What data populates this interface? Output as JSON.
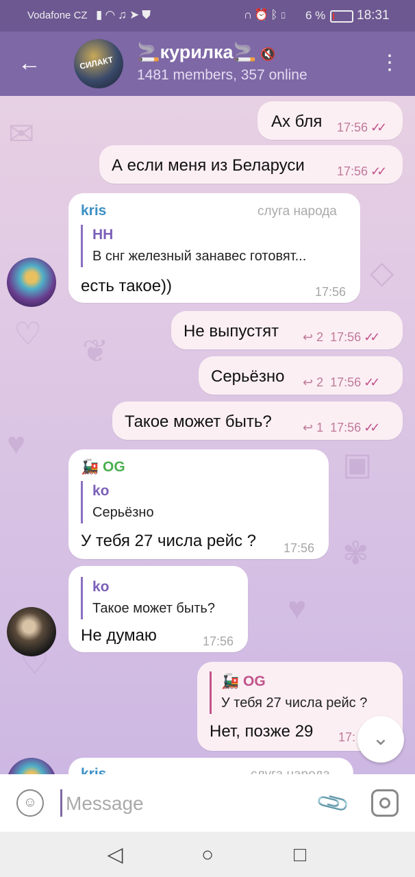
{
  "status_bar": {
    "carrier": "Vodafone CZ",
    "battery": "6 %",
    "time": "18:31",
    "battery_level": 0.06,
    "battery_color": "#e53935"
  },
  "header": {
    "title": "курилка",
    "title_emoji": "🚬",
    "subtitle": "1481 members, 357 online",
    "avatar_text": "СИЛАКТ"
  },
  "messages": [
    {
      "text": "Ах бля",
      "time": "17:56"
    },
    {
      "text": "А если меня из Беларуси",
      "time": "17:56"
    },
    {
      "sender": "kris",
      "role": "слуга народа",
      "quote_name": "НН",
      "quote_text": "В снг железный занавес готовят...",
      "text": "есть такое))",
      "time": "17:56"
    },
    {
      "text": "Не выпустят",
      "replies": "2",
      "time": "17:56"
    },
    {
      "text": "Серьёзно",
      "replies": "2",
      "time": "17:56"
    },
    {
      "text": "Такое может быть?",
      "replies": "1",
      "time": "17:56"
    },
    {
      "sender": "🚂 OG",
      "quote_name": "ko",
      "quote_text": "Серьёзно",
      "text": "У тебя 27 числа рейс ?",
      "time": "17:56"
    },
    {
      "quote_name": "ko",
      "quote_text": "Такое может быть?",
      "text": "Не думаю",
      "time": "17:56"
    },
    {
      "quote_name": "🚂 OG",
      "quote_text": "У тебя 27 числа рейс ?",
      "text": "Нет, позже 29",
      "time": "17:"
    },
    {
      "sender": "kris",
      "role": "слуга народа"
    }
  ],
  "composer": {
    "placeholder": "Message"
  },
  "colors": {
    "header": "#7e68a6",
    "status": "#6d5892",
    "outgoing_bubble": "#fbeff4",
    "check": "#c0538a",
    "sender_kris": "#3b8fc4",
    "sender_og": "#4caf50"
  }
}
